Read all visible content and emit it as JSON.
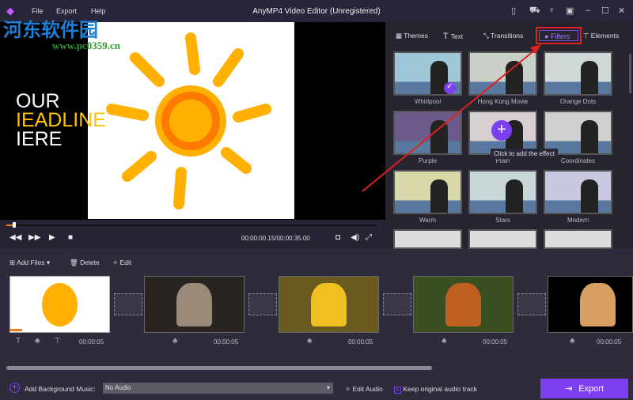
{
  "app": {
    "title": "AnyMP4 Video Editor (Unregistered)",
    "menu": [
      "File",
      "Export",
      "Help"
    ]
  },
  "watermark": {
    "text": "河东软件园",
    "url": "www.pc0359.cn"
  },
  "preview": {
    "headline": [
      "OUR",
      "IEADLINE",
      "IERE"
    ],
    "time": "00:00:00.15/00:00:35.00",
    "progress_percent": 0.4
  },
  "panel": {
    "tabs": [
      "Themes",
      "Text",
      "Transitions",
      "Filters",
      "Elements"
    ],
    "active_tab": "Filters",
    "filters": [
      "Whirlpool",
      "Hong Kong Movie",
      "Orange Dots",
      "Purple",
      "Plain",
      "Coordinates",
      "Warm",
      "Stars",
      "Modern"
    ],
    "tooltip": "Click to add the effect"
  },
  "toolbar": {
    "add_files": "Add Files",
    "delete": "Delete",
    "edit": "Edit"
  },
  "clips": [
    {
      "duration": "00:00:05"
    },
    {
      "duration": "00:00:05"
    },
    {
      "duration": "00:00:05"
    },
    {
      "duration": "00:00:05"
    },
    {
      "duration": "00:00:05"
    }
  ],
  "bottom": {
    "add_music": "Add Background Music:",
    "audio_value": "No Audio",
    "edit_audio": "Edit Audio",
    "keep_audio": "Keep original audio track",
    "keep_audio_checked": true,
    "export": "Export"
  },
  "colors": {
    "accent": "#7c3ff2",
    "highlight": "#e02020"
  }
}
